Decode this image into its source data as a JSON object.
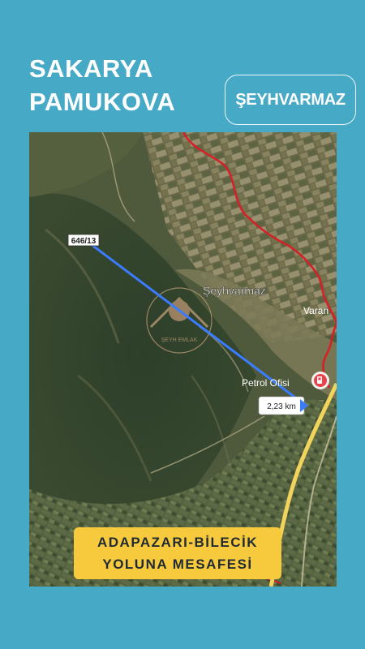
{
  "header": {
    "title_line1": "SAKARYA",
    "title_line2": "PAMUKOVA",
    "village": "ŞEYHVARMAZ"
  },
  "map": {
    "parcel_label": "646/13",
    "village_label": "Şeyhvarmaz",
    "partial_label": "Varan",
    "poi_label": "Petrol Ofisi",
    "distance_label": "2,23 km",
    "watermark_text": "ŞEYH EMLAK",
    "colors": {
      "measure_line": "#3b7cff",
      "boundary": "#d91f26",
      "highway": "#f2d45c",
      "poi_marker": "#ffffff"
    }
  },
  "banner": {
    "line1": "ADAPAZARI-BİLECİK",
    "line2": "YOLUNA MESAFESİ"
  }
}
